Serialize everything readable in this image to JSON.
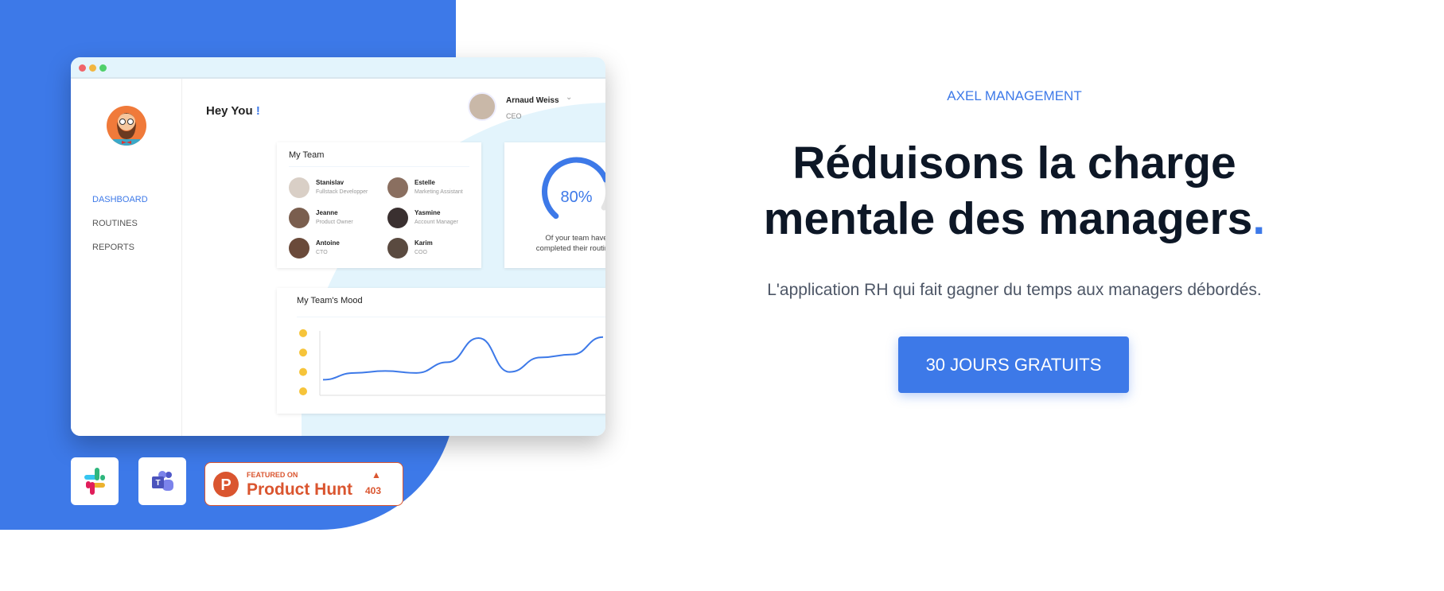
{
  "app_window": {
    "sidebar": {
      "items": [
        {
          "label": "DASHBOARD",
          "active": true
        },
        {
          "label": "ROUTINES",
          "active": false
        },
        {
          "label": "REPORTS",
          "active": false
        }
      ]
    },
    "header": {
      "greeting": "Hey You",
      "greeting_mark": "!",
      "user_name": "Arnaud Weiss",
      "user_role": "CEO"
    },
    "team": {
      "title": "My Team",
      "members": [
        {
          "name": "Stanislav",
          "role": "Fullstack Developper"
        },
        {
          "name": "Estelle",
          "role": "Marketing Assistant"
        },
        {
          "name": "Jeanne",
          "role": "Product Owner"
        },
        {
          "name": "Yasmine",
          "role": "Account Manager"
        },
        {
          "name": "Antoine",
          "role": "CTO"
        },
        {
          "name": "Karim",
          "role": "COO"
        }
      ]
    },
    "routines": {
      "percent": 80,
      "percent_label": "80%",
      "caption_line1": "Of your team have",
      "caption_line2": "completed their routines"
    },
    "mood": {
      "title": "My Team's Mood"
    }
  },
  "chart_data": {
    "type": "line",
    "title": "My Team's Mood",
    "y_levels": [
      "very-sad-emoji",
      "sad-emoji",
      "happy-emoji",
      "very-happy-emoji"
    ],
    "x": [
      0,
      1,
      2,
      3,
      4,
      5,
      6,
      7,
      8,
      9
    ],
    "values": [
      1.6,
      1.95,
      2.05,
      1.95,
      2.5,
      3.75,
      2.0,
      2.75,
      2.9,
      3.8
    ],
    "grid": false
  },
  "badges": {
    "slack": "slack-logo",
    "teams": "teams-logo",
    "product_hunt": {
      "featured": "FEATURED ON",
      "name": "Product Hunt",
      "votes": "403"
    }
  },
  "hero": {
    "eyebrow": "AXEL MANAGEMENT",
    "headline_line1": "Réduisons la charge",
    "headline_line2": "mentale des managers",
    "headline_period": ".",
    "subtitle": "L'application RH qui fait gagner du temps aux managers débordés.",
    "cta": "30 JOURS GRATUITS"
  },
  "colors": {
    "brand": "#3d79e8",
    "headline": "#0d1726",
    "product_hunt": "#da552f"
  }
}
